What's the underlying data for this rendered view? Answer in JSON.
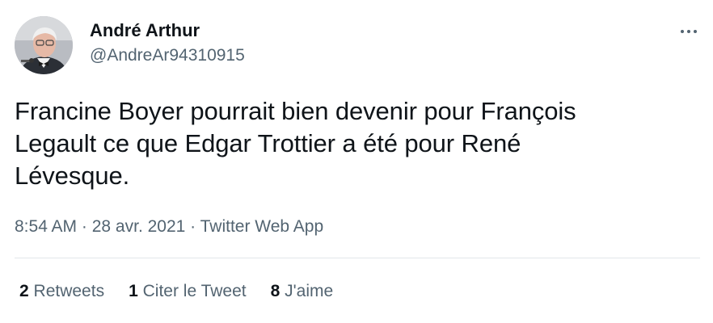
{
  "author": {
    "name": "André Arthur",
    "handle": "@AndreAr94310915"
  },
  "tweet": {
    "text_lines": [
      "Francine Boyer pourrait bien devenir pour François",
      "Legault ce que Edgar Trottier a été pour René",
      "Lévesque."
    ]
  },
  "meta": {
    "time": "8:54 AM",
    "separator": " · ",
    "date": "28 avr. 2021",
    "source": "Twitter Web App"
  },
  "stats": {
    "retweets": {
      "count": "2",
      "label": "Retweets"
    },
    "quotes": {
      "count": "1",
      "label": "Citer le Tweet"
    },
    "likes": {
      "count": "8",
      "label": "J'aime"
    }
  },
  "icons": {
    "more": "more-dots-icon"
  },
  "colors": {
    "primary_text": "#0f1419",
    "secondary_text": "#536471",
    "divider": "#e3e7ea"
  }
}
